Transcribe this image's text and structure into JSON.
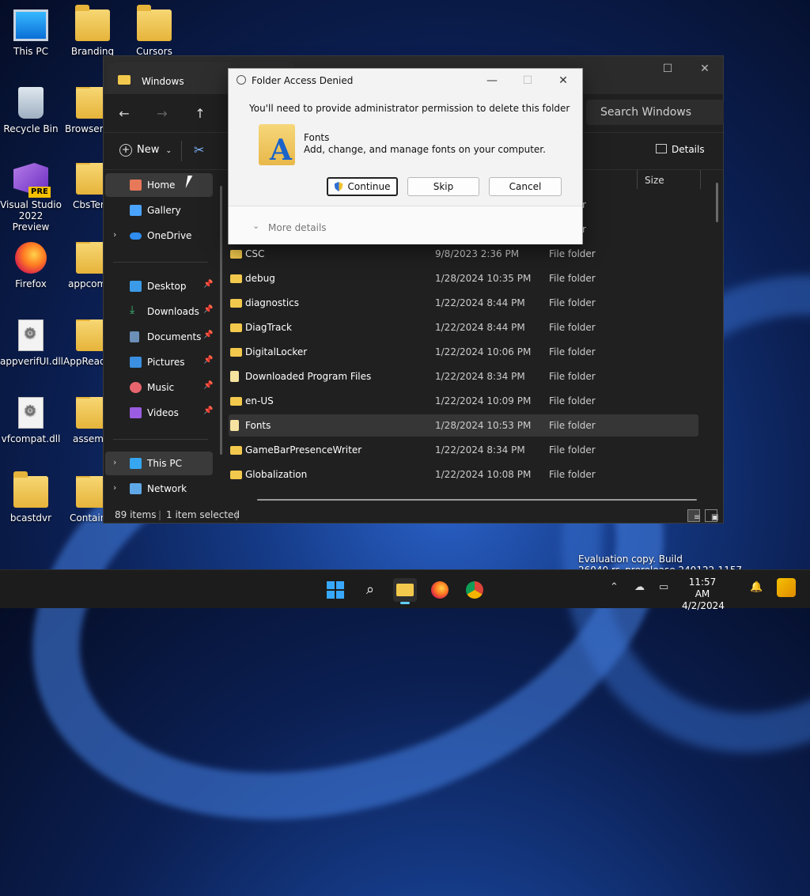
{
  "desktop": {
    "icons": [
      {
        "label": "This PC"
      },
      {
        "label": "Branding"
      },
      {
        "label": "Cursors"
      },
      {
        "label": "Recycle Bin"
      },
      {
        "label": "BrowserC"
      },
      {
        "label": "Visual Studio 2022 Preview"
      },
      {
        "label": "CbsTem"
      },
      {
        "label": "Firefox"
      },
      {
        "label": "appcom"
      },
      {
        "label": "appverifUI.dll"
      },
      {
        "label": "AppReadi"
      },
      {
        "label": "vfcompat.dll"
      },
      {
        "label": "assemb"
      },
      {
        "label": "bcastdvr"
      },
      {
        "label": "Contain"
      }
    ],
    "vs_badge": "PRE"
  },
  "explorer": {
    "tab_title": "Windows",
    "search_placeholder": "Search Windows",
    "new_label": "New",
    "details_label": "Details",
    "size_column": "Size",
    "sidebar": [
      {
        "label": "Home"
      },
      {
        "label": "Gallery"
      },
      {
        "label": "OneDrive"
      },
      {
        "label": "Desktop"
      },
      {
        "label": "Downloads"
      },
      {
        "label": "Documents"
      },
      {
        "label": "Pictures"
      },
      {
        "label": "Music"
      },
      {
        "label": "Videos"
      },
      {
        "label": "This PC"
      },
      {
        "label": "Network"
      }
    ],
    "partial_rows": [
      {
        "type": "older"
      },
      {
        "type": "older"
      }
    ],
    "files": [
      {
        "name": "CSC",
        "date": "9/8/2023 2:36 PM",
        "type": "File folder"
      },
      {
        "name": "debug",
        "date": "1/28/2024 10:35 PM",
        "type": "File folder"
      },
      {
        "name": "diagnostics",
        "date": "1/22/2024 8:44 PM",
        "type": "File folder"
      },
      {
        "name": "DiagTrack",
        "date": "1/22/2024 8:44 PM",
        "type": "File folder"
      },
      {
        "name": "DigitalLocker",
        "date": "1/22/2024 10:06 PM",
        "type": "File folder"
      },
      {
        "name": "Downloaded Program Files",
        "date": "1/22/2024 8:34 PM",
        "type": "File folder"
      },
      {
        "name": "en-US",
        "date": "1/22/2024 10:09 PM",
        "type": "File folder"
      },
      {
        "name": "Fonts",
        "date": "1/28/2024 10:53 PM",
        "type": "File folder"
      },
      {
        "name": "GameBarPresenceWriter",
        "date": "1/22/2024 8:34 PM",
        "type": "File folder"
      },
      {
        "name": "Globalization",
        "date": "1/22/2024 10:08 PM",
        "type": "File folder"
      }
    ],
    "status_count": "89 items",
    "status_selected": "1 item selected"
  },
  "dialog": {
    "title": "Folder Access Denied",
    "message": "You'll need to provide administrator permission to delete this folder",
    "folder_name": "Fonts",
    "folder_desc": "Add, change, and manage fonts on your computer.",
    "continue_label": "Continue",
    "skip_label": "Skip",
    "cancel_label": "Cancel",
    "more_details": "More details"
  },
  "watermark": "Evaluation copy. Build 26040.rs_prerelease.240122-1157",
  "taskbar": {
    "time": "11:57 AM",
    "date": "4/2/2024"
  },
  "colors": {
    "accent": "#60cdff",
    "folder": "#f2c94c",
    "selection": "#363636"
  }
}
